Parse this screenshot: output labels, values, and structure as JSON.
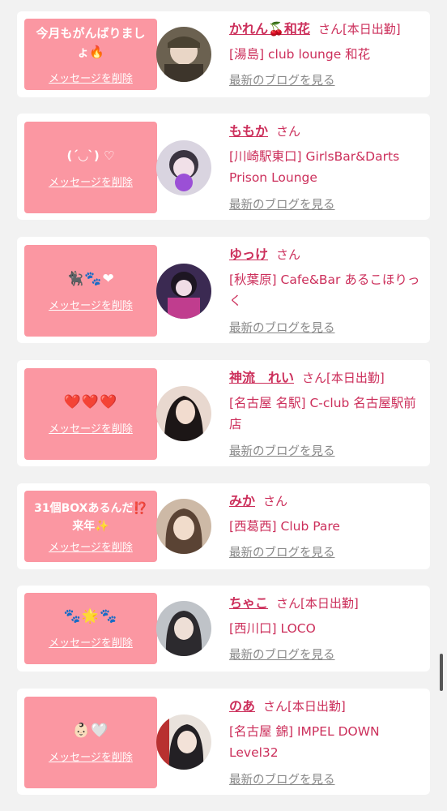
{
  "items": [
    {
      "message": "今月もがんばりましょ🔥",
      "delete_label": "メッセージを削除",
      "name": "かれん🍒和花",
      "san": "さん",
      "status": "[本日出勤]",
      "shop": "[湯島] club lounge 和花",
      "blog_label": "最新のブログを見る"
    },
    {
      "message": "(ˊ◡ˋ) ♡",
      "delete_label": "メッセージを削除",
      "name": "ももか",
      "san": "さん",
      "status": "",
      "shop": "[川崎駅東口] GirlsBar&Darts Prison Lounge",
      "blog_label": "最新のブログを見る"
    },
    {
      "message": "🐈‍⬛🐾❤",
      "delete_label": "メッセージを削除",
      "name": "ゆっけ",
      "san": "さん",
      "status": "",
      "shop": "[秋葉原] Cafe&Bar あるこほりっく",
      "blog_label": "最新のブログを見る"
    },
    {
      "message": "❤️❤️❤️",
      "delete_label": "メッセージを削除",
      "name": "神流　れい",
      "san": "さん",
      "status": "[本日出勤]",
      "shop": "[名古屋 名駅] C-club 名古屋駅前店",
      "blog_label": "最新のブログを見る"
    },
    {
      "message": "31個BOXあるんだ⁉️来年✨",
      "delete_label": "メッセージを削除",
      "name": "みか",
      "san": "さん",
      "status": "",
      "shop": "[西葛西] Club Pare",
      "blog_label": "最新のブログを見る"
    },
    {
      "message": "🐾🌟🐾",
      "delete_label": "メッセージを削除",
      "name": "ちゃこ",
      "san": "さん",
      "status": "[本日出勤]",
      "shop": "[西川口] LOCO",
      "blog_label": "最新のブログを見る"
    },
    {
      "message": "👶🏻🤍",
      "delete_label": "メッセージを削除",
      "name": "のあ",
      "san": "さん",
      "status": "[本日出勤]",
      "shop": "[名古屋 錦] IMPEL DOWN Level32",
      "blog_label": "最新のブログを見る"
    }
  ],
  "colors": {
    "bubble": "#fb97a2",
    "accent_text": "#cc2f5b",
    "link_gray": "#888888",
    "page_bg": "#f2f2f2"
  }
}
